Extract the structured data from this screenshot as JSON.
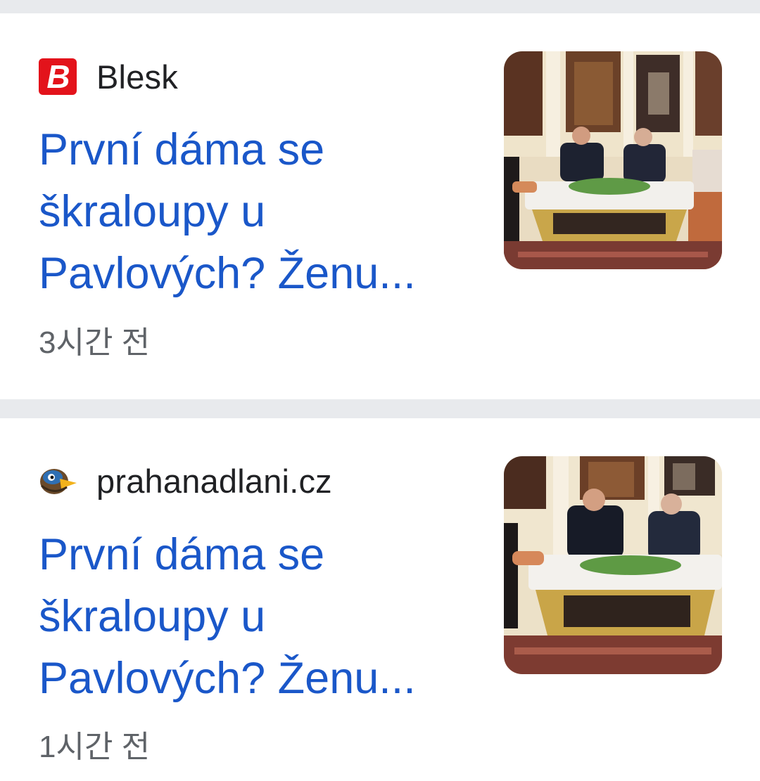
{
  "articles": [
    {
      "source": "Blesk",
      "headline": "První dáma se škraloupy u Pavlových? Ženu...",
      "time": "3시간 전",
      "favicon": "blesk-logo-icon",
      "favicon_letter": "B",
      "favicon_color": "#e3131b"
    },
    {
      "source": "prahanadlani.cz",
      "headline": "První dáma se škraloupy u Pavlových? Ženu...",
      "time": "1시간 전",
      "favicon": "prahanadlani-bird-logo-icon"
    }
  ],
  "colors": {
    "headline": "#1a57c9",
    "source": "#202124",
    "timestamp": "#5f6368",
    "divider": "#e8eaed"
  }
}
